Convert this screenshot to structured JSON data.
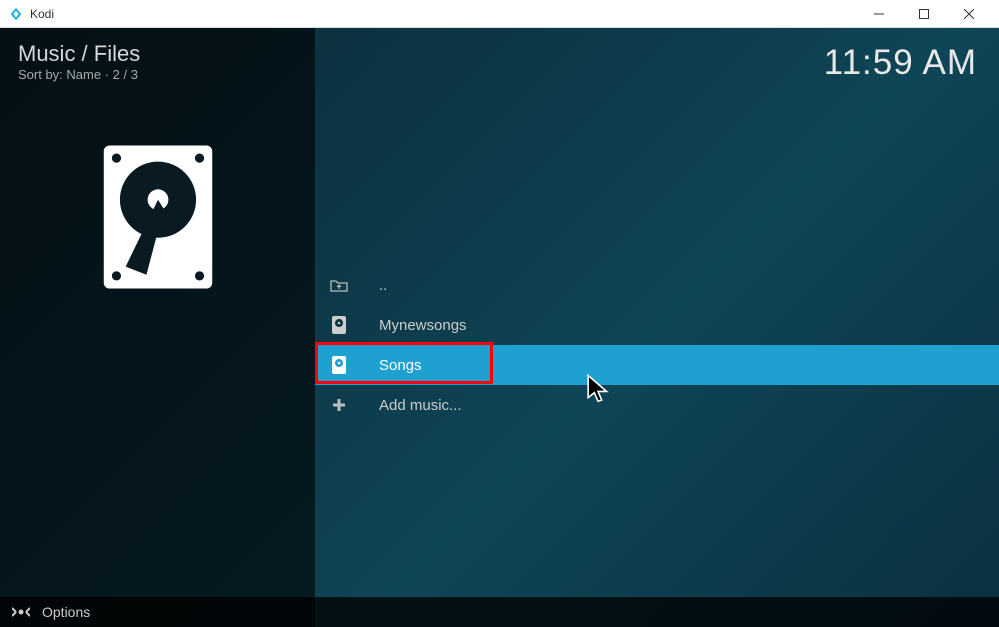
{
  "titlebar": {
    "app_name": "Kodi"
  },
  "header": {
    "breadcrumb": "Music / Files",
    "sort_label": "Sort by: Name  ·  2 / 3",
    "clock": "11:59 AM"
  },
  "file_list": {
    "items": [
      {
        "label": "..",
        "icon": "folder-up-icon",
        "selected": false
      },
      {
        "label": "Mynewsongs",
        "icon": "source-icon",
        "selected": false
      },
      {
        "label": "Songs",
        "icon": "source-icon",
        "selected": true
      },
      {
        "label": "Add music...",
        "icon": "plus-icon",
        "selected": false
      }
    ]
  },
  "footer": {
    "options_label": "Options"
  }
}
